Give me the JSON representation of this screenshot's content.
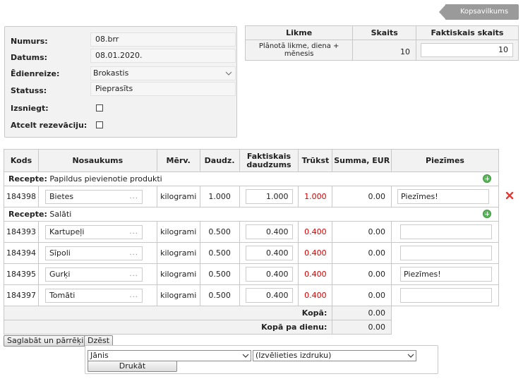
{
  "header": {
    "summary_tab": "Kopsavilkums"
  },
  "info": {
    "rows": [
      {
        "label": "Numurs:",
        "value": "08.brr"
      },
      {
        "label": "Datums:",
        "value": "08.01.2020."
      },
      {
        "label": "Ēdienreize:",
        "value": "Brokastis"
      },
      {
        "label": "Statuss:",
        "value": "Pieprasīts"
      },
      {
        "label": "Izsniegt:"
      },
      {
        "label": "Atcelt rezevāciju:"
      }
    ]
  },
  "rate": {
    "headers": [
      "Likme",
      "Skaits",
      "Faktiskais skaits"
    ],
    "row": {
      "name": "Plānotā likme, diena + mēnesis",
      "count": "10",
      "actual": "10"
    }
  },
  "products": {
    "headers": [
      "Kods",
      "Nosaukums",
      "Mērv.",
      "Daudz.",
      "Faktiskais daudzums",
      "Trūkst",
      "Summa, EUR",
      "Piezīmes"
    ],
    "recipe_prefix": "Recepte:",
    "groups": [
      {
        "recipe": "Papildus pievienotie produkti",
        "items": [
          {
            "code": "184398",
            "name": "Bietes",
            "unit": "kilogrami",
            "qty": "1.000",
            "actual": "1.000",
            "missing": "1.000",
            "sum": "0.00",
            "note": "Piezīmes!"
          }
        ]
      },
      {
        "recipe": "Salāti",
        "items": [
          {
            "code": "184393",
            "name": "Kartupeļi",
            "unit": "kilogrami",
            "qty": "0.500",
            "actual": "0.400",
            "missing": "0.400",
            "sum": "0.00",
            "note": ""
          },
          {
            "code": "184394",
            "name": "Sīpoli",
            "unit": "kilogrami",
            "qty": "0.500",
            "actual": "0.400",
            "missing": "0.400",
            "sum": "0.00",
            "note": ""
          },
          {
            "code": "184395",
            "name": "Gurķi",
            "unit": "kilogrami",
            "qty": "0.500",
            "actual": "0.400",
            "missing": "0.400",
            "sum": "0.00",
            "note": "Piezīmes!"
          },
          {
            "code": "184397",
            "name": "Tomāti",
            "unit": "kilogrami",
            "qty": "0.500",
            "actual": "0.400",
            "missing": "0.400",
            "sum": "0.00",
            "note": ""
          }
        ]
      }
    ],
    "ellipsis": "...",
    "total_label": "Kopā:",
    "total_value": "0.00",
    "day_total_label": "Kopā pa dienu:",
    "day_total_value": "0.00"
  },
  "actions": {
    "save_label": "Saglabāt un pārrēķināt",
    "delete_label": "Dzēst",
    "person_select": "Jānis",
    "print_select": "(Izvēlieties izdruku)",
    "print_label": "Drukāt"
  },
  "colors": {
    "missing": "#d40000",
    "add": "#5bb85b",
    "delete": "#e53935",
    "tab": "#9a9a9a"
  }
}
